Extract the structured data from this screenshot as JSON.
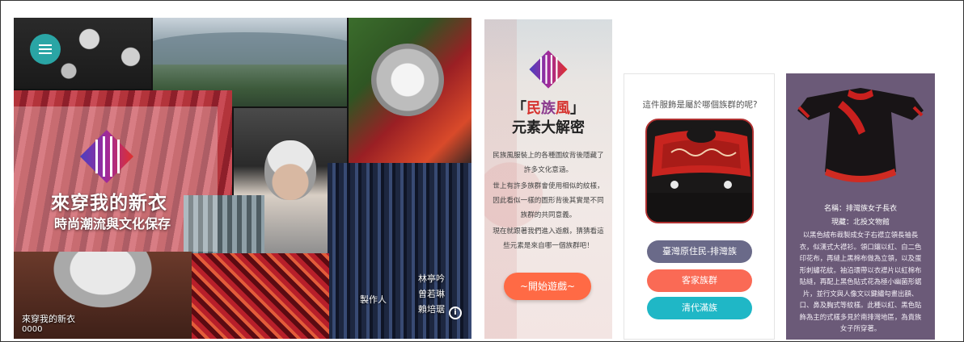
{
  "landing": {
    "title": "來穿我的新衣",
    "subtitle": "時尚潮流與文化保存",
    "caption_name": "來穿我的新衣",
    "caption_count": "0000",
    "credit_label": "製作人",
    "credits": [
      "林亭吟",
      "曾若琳",
      "賴培琚"
    ],
    "menu_icon": "menu-icon",
    "info_icon": "info-icon",
    "accent_color": "#2aa5a5"
  },
  "intro": {
    "title_open": "「",
    "title_word1": "民",
    "title_word2": "族",
    "title_word3": "風",
    "title_close": "」",
    "title_line2": "元素大解密",
    "paragraphs": [
      "民族風服裝上的各種圖紋背後隱藏了許多文化意涵。",
      "世上有許多族群會使用相似的紋樣，因此看似一樣的圖形背後其實是不同族群的共同意義。",
      "現在就跟著我們進入遊戲，猜猜看這些元素是來自哪一個族群吧！"
    ],
    "start_button": "~開始遊戲~"
  },
  "quiz": {
    "question": "這件服飾是屬於哪個族群的呢?",
    "options": [
      "臺灣原住民-排灣族",
      "客家族群",
      "清代滿族"
    ],
    "option_colors": [
      "#6a6a89",
      "#fa6a55",
      "#1fb7c6"
    ]
  },
  "detail": {
    "name": "名稱：排灣族女子長衣",
    "source": "現藏：北投文物館",
    "description": "以黑色絨布裁製成女子右襟立領長袖長衣，似漢式大襟衫。領口鑲以紅、白二色印花布，再縫上黑棉布做為立領，以及蛋形刺繡花紋。袖沿環帶以衣襟片以紅棉布貼縫，再配上黑色貼式花為極小幽菌形鋸片，並行文與人像文以鍵繡勾畫出額、口、鼻及胸式等紋樣。此種以紅、黑色貼飾為主的式樣多見於南排灣地區，為貴族女子所穿著。",
    "background_color": "#6b5a78"
  }
}
